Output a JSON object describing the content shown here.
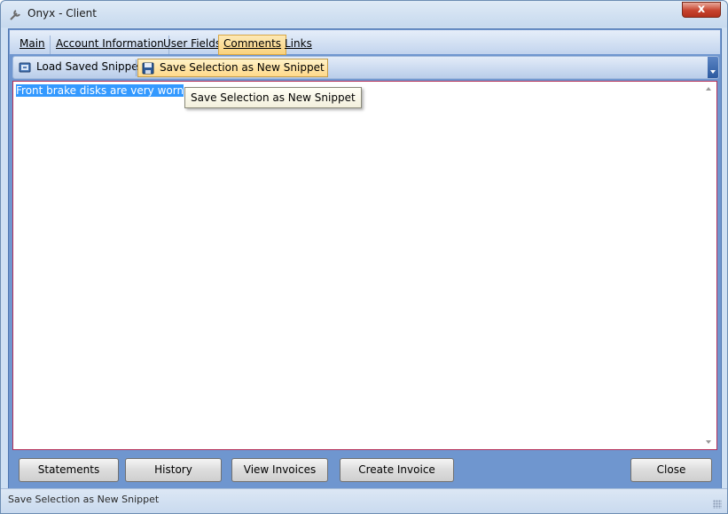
{
  "window": {
    "title": "Onyx - Client",
    "close_label": "x"
  },
  "tabs": [
    {
      "label": "Main",
      "active": false
    },
    {
      "label": "Account Information",
      "active": false
    },
    {
      "label": "User Fields",
      "active": false
    },
    {
      "label": "Comments",
      "active": true
    },
    {
      "label": "Links",
      "active": false
    }
  ],
  "toolbar": {
    "load_label": "Load Saved Snippet",
    "save_label": "Save Selection as New Snippet"
  },
  "editor": {
    "selected_text": "Front brake disks are very worn"
  },
  "tooltip": {
    "text": "Save Selection as New Snippet"
  },
  "buttons": {
    "statements": "Statements",
    "history": "History",
    "view_invoices": "View Invoices",
    "create_invoice": "Create Invoice",
    "close": "Close"
  },
  "status": {
    "text": "Save Selection as New Snippet"
  },
  "colors": {
    "active_tab": "#fad27d",
    "selection": "#3399ff",
    "frame": "#6f96cf"
  }
}
